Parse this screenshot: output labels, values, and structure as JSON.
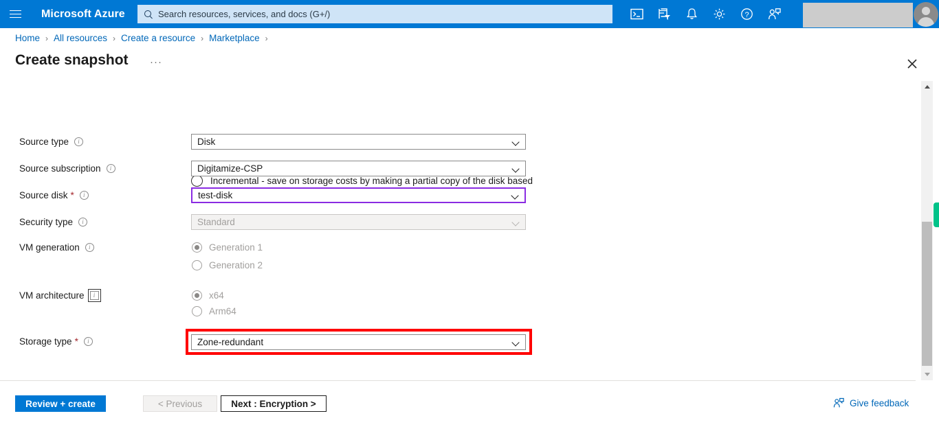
{
  "topbar": {
    "menu_icon": "hamburger-icon",
    "brand": "Microsoft Azure",
    "search_placeholder": "Search resources, services, and docs (G+/)",
    "icons": [
      {
        "name": "cloud-shell-icon",
        "title": "Cloud Shell"
      },
      {
        "name": "directory-filter-icon",
        "title": "Directories + subscriptions"
      },
      {
        "name": "notifications-bell-icon",
        "title": "Notifications"
      },
      {
        "name": "settings-gear-icon",
        "title": "Settings"
      },
      {
        "name": "help-question-icon",
        "title": "Help"
      },
      {
        "name": "feedback-person-icon",
        "title": "Feedback"
      }
    ],
    "account_redacted": "",
    "avatar": "user-avatar"
  },
  "breadcrumb": {
    "items": [
      "Home",
      "All resources",
      "Create a resource",
      "Marketplace"
    ],
    "separator": "›",
    "trailing_separator": "›"
  },
  "page": {
    "title": "Create snapshot",
    "overflow_menu": "···",
    "close_icon": "close-icon"
  },
  "form": {
    "incremental_option": {
      "label": "Incremental - save on storage costs by making a partial copy of the disk based on the difference between the last snapshot.",
      "selected": false
    },
    "fields": [
      {
        "label": "Source type",
        "required": false,
        "info": true,
        "control": "dropdown",
        "value": "Disk",
        "state": "normal"
      },
      {
        "label": "Source subscription",
        "required": false,
        "info": true,
        "control": "dropdown",
        "value": "Digitamize-CSP",
        "state": "normal"
      },
      {
        "label": "Source disk",
        "required": true,
        "info": true,
        "control": "dropdown",
        "value": "test-disk",
        "state": "focused"
      },
      {
        "label": "Security type",
        "required": false,
        "info": true,
        "control": "dropdown",
        "value": "Standard",
        "state": "disabled"
      }
    ],
    "vm_generation": {
      "label": "VM generation",
      "info": true,
      "options": [
        {
          "label": "Generation 1",
          "selected": true,
          "disabled": true
        },
        {
          "label": "Generation 2",
          "selected": false,
          "disabled": true
        }
      ]
    },
    "vm_architecture": {
      "label": "VM architecture",
      "info": true,
      "info_focused": true,
      "options": [
        {
          "label": "x64",
          "selected": true,
          "disabled": true
        },
        {
          "label": "Arm64",
          "selected": false,
          "disabled": true
        }
      ]
    },
    "storage_type": {
      "label": "Storage type",
      "required": true,
      "info": true,
      "value": "Zone-redundant",
      "highlighted": true,
      "highlight_color": "#ff0000"
    }
  },
  "scrollbar": {
    "up_arrow": "scroll-up-arrow",
    "down_arrow": "scroll-down-arrow",
    "thumb": "scroll-thumb",
    "marker_color": "#00c389"
  },
  "footer": {
    "review_create": "Review + create",
    "previous": "< Previous",
    "next": "Next : Encryption >",
    "give_feedback": "Give feedback"
  },
  "colors": {
    "azure_blue": "#0078d4",
    "link_blue": "#0067b8",
    "required_red": "#a4262c",
    "focus_purple": "#8a2be2",
    "highlight_red": "#ff0000",
    "green_marker": "#00c389"
  }
}
